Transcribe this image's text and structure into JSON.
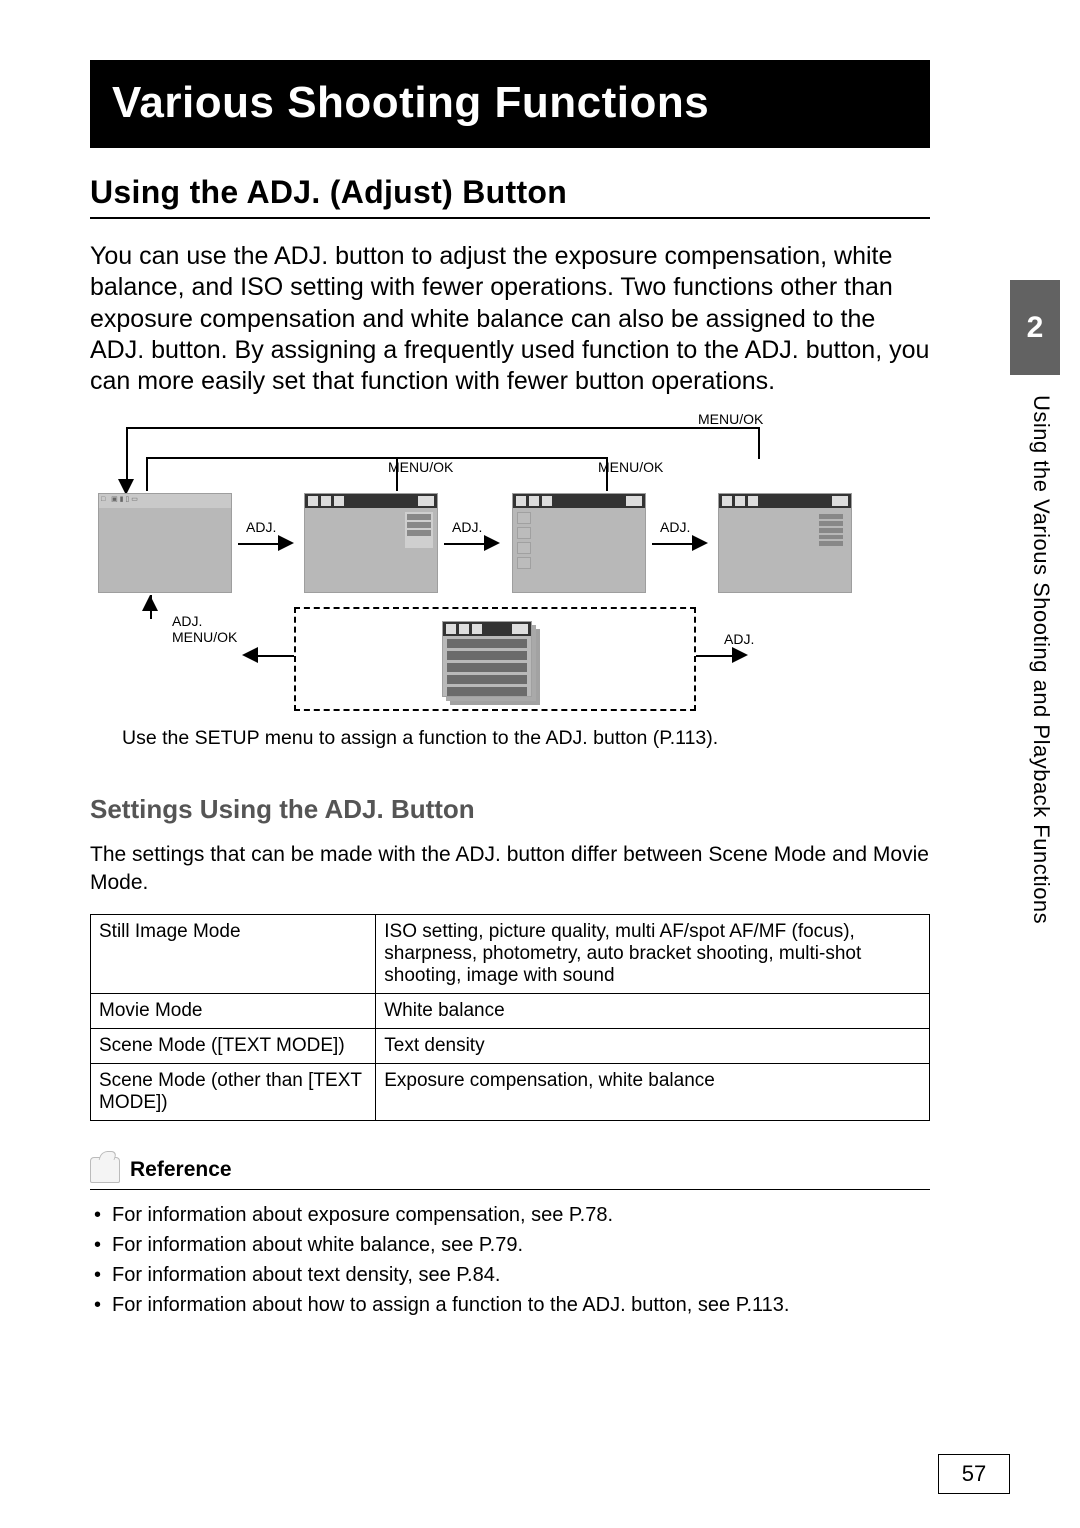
{
  "chapter_title": "Various Shooting Functions",
  "section_heading": "Using the ADJ. (Adjust) Button",
  "intro_paragraph": "You can use the ADJ. button to adjust the exposure compensation, white balance, and ISO setting with fewer operations. Two functions other than exposure compensation and white balance can also be assigned to the ADJ. button. By assigning a frequently used function to the ADJ. button, you can more easily set that function with fewer button operations.",
  "diagram": {
    "labels": {
      "menu_ok": "MENU/OK",
      "adj": "ADJ."
    },
    "caption": "Use the SETUP menu to assign a function to the ADJ. button (P.113)."
  },
  "settings": {
    "heading": "Settings Using the ADJ. Button",
    "body": "The settings that can be made with the ADJ. button differ between Scene Mode and Movie Mode.",
    "table": [
      {
        "mode": "Still Image Mode",
        "settings": "ISO setting, picture quality, multi AF/spot AF/MF (focus), sharpness, photometry, auto bracket shooting, multi-shot shooting, image with sound"
      },
      {
        "mode": "Movie Mode",
        "settings": "White balance"
      },
      {
        "mode": "Scene Mode ([TEXT MODE])",
        "settings": "Text density"
      },
      {
        "mode": "Scene Mode (other than [TEXT MODE])",
        "settings": "Exposure compensation, white balance"
      }
    ]
  },
  "reference": {
    "heading": "Reference",
    "items": [
      "For information about exposure compensation, see P.78.",
      "For information about white balance, see P.79.",
      "For information about text density, see P.84.",
      "For information about how to assign a function to the ADJ. button, see P.113."
    ]
  },
  "side_tab": {
    "number": "2",
    "text": "Using the Various Shooting and Playback Functions"
  },
  "page_number": "57"
}
